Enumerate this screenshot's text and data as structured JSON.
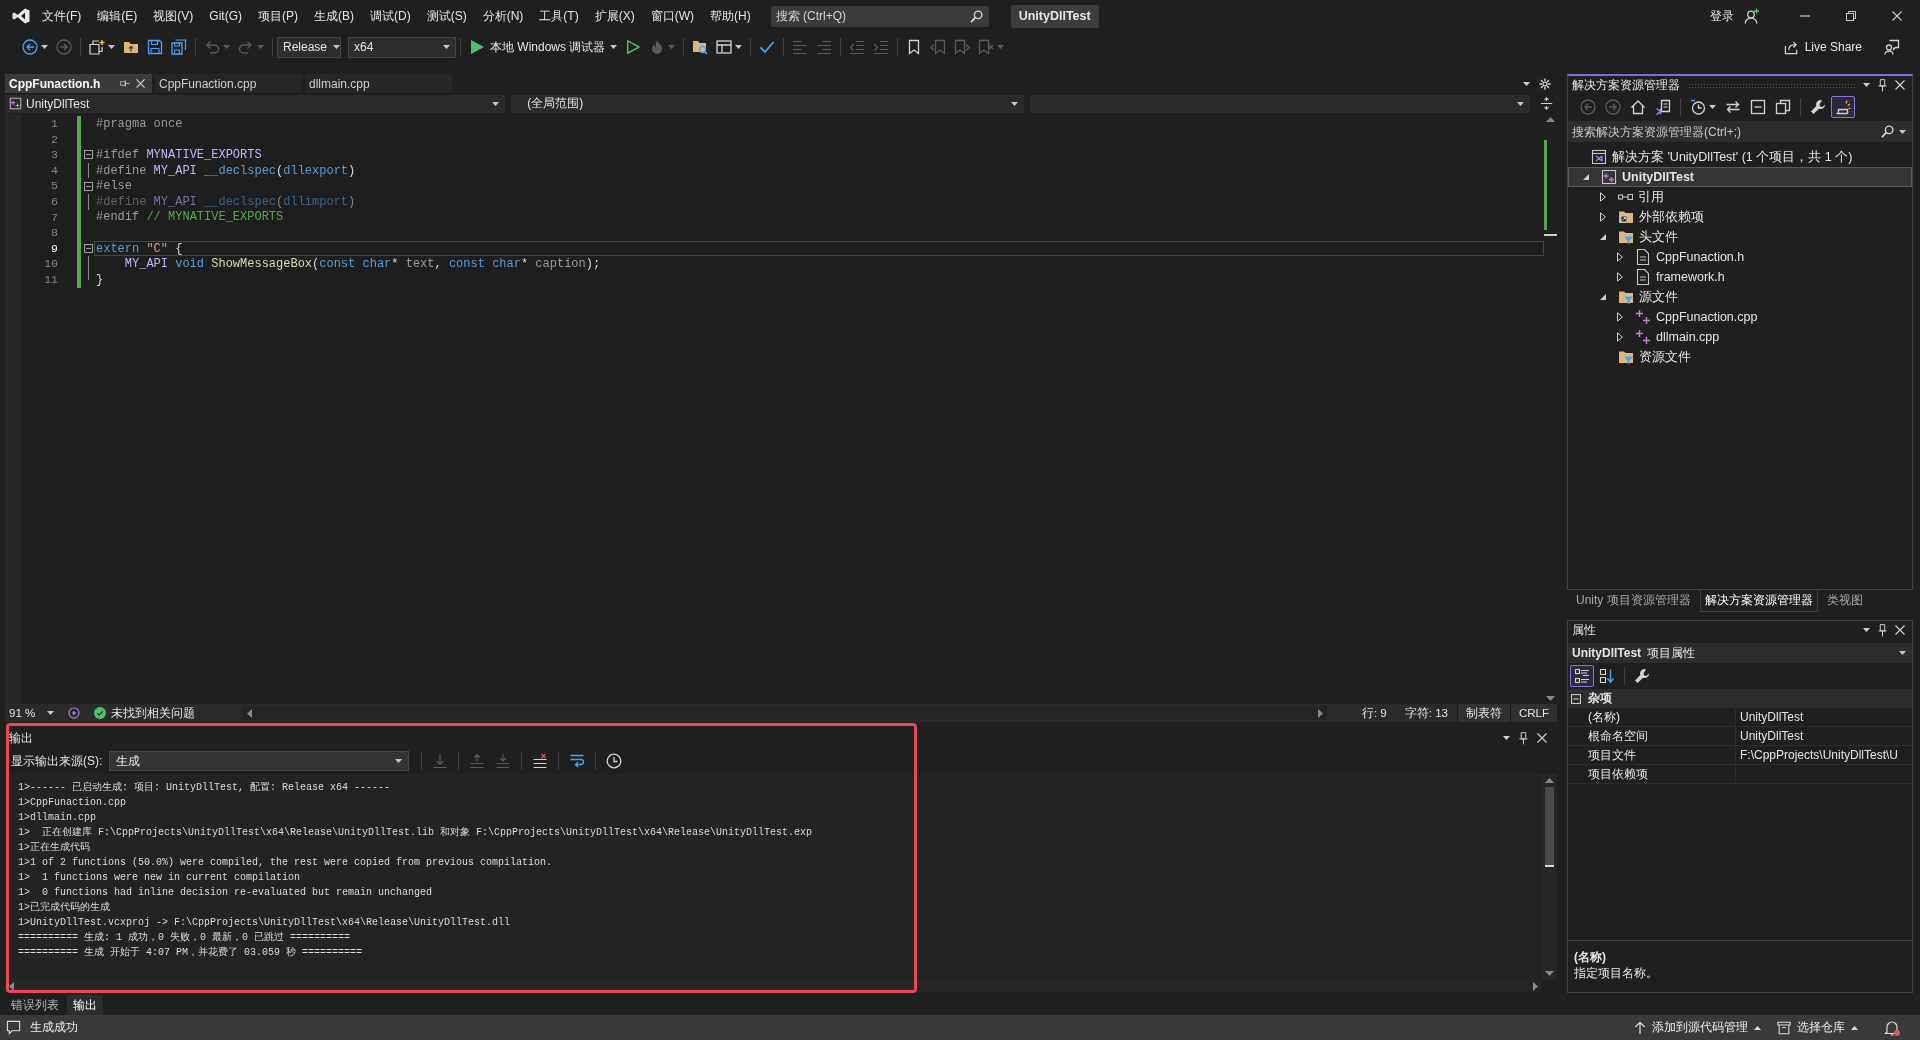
{
  "window": {
    "search": {
      "placeholder": "搜索 (Ctrl+Q)"
    },
    "solution_name": "UnityDllTest",
    "sign_in": "登录"
  },
  "menu": [
    "文件(F)",
    "编辑(E)",
    "视图(V)",
    "Git(G)",
    "项目(P)",
    "生成(B)",
    "调试(D)",
    "测试(S)",
    "分析(N)",
    "工具(T)",
    "扩展(X)",
    "窗口(W)",
    "帮助(H)"
  ],
  "toolbar": {
    "groups": [
      [
        {
          "kind": "back",
          "disabled": false,
          "dropdown": true
        },
        {
          "kind": "forward",
          "disabled": true
        }
      ],
      [
        {
          "kind": "new_item",
          "disabled": false,
          "dropdown": true
        },
        {
          "kind": "open",
          "disabled": false
        },
        {
          "kind": "save",
          "disabled": false
        },
        {
          "kind": "save_all",
          "disabled": false
        }
      ],
      [
        {
          "kind": "undo",
          "disabled": true,
          "dropdown": true
        },
        {
          "kind": "redo",
          "disabled": true,
          "dropdown": true
        }
      ],
      [
        {
          "kind": "configuration",
          "value": "Release"
        },
        {
          "kind": "platform",
          "value": "x64"
        }
      ],
      [
        {
          "kind": "run",
          "label": "本地 Windows 调试器",
          "disabled": false,
          "dropdown": true
        },
        {
          "kind": "run_outline",
          "disabled": false
        },
        {
          "kind": "hot_reload",
          "disabled": true,
          "dropdown": true
        }
      ],
      [
        {
          "kind": "find_folder",
          "disabled": false
        },
        {
          "kind": "layout",
          "disabled": false,
          "dropdown": true
        }
      ],
      [
        {
          "kind": "spellcheck",
          "disabled": false
        }
      ],
      [
        {
          "kind": "comment",
          "disabled": true
        },
        {
          "kind": "uncomment",
          "disabled": true
        }
      ],
      [
        {
          "kind": "outdent",
          "disabled": true
        },
        {
          "kind": "indent",
          "disabled": true
        }
      ],
      [
        {
          "kind": "bookmark",
          "disabled": false
        },
        {
          "kind": "bookmark_prev",
          "disabled": true
        },
        {
          "kind": "bookmark_next",
          "disabled": true
        },
        {
          "kind": "bookmark_clear",
          "disabled": true,
          "dropdown": true
        }
      ]
    ],
    "live_share": "Live Share"
  },
  "document_tabs": [
    {
      "label": "CppFunaction.h",
      "selected": true
    },
    {
      "label": "CppFunaction.cpp",
      "selected": false
    },
    {
      "label": "dllmain.cpp",
      "selected": false
    }
  ],
  "navigation_bar": {
    "project": "UnityDllTest",
    "scope": "(全局范围)"
  },
  "editor": {
    "lines": [
      {
        "number": "1",
        "kind": "plain",
        "tokens": [
          {
            "kind": "preprocessor",
            "text": "#pragma once"
          }
        ],
        "changed": true,
        "current": false,
        "inactive": false
      },
      {
        "number": "2",
        "kind": "plain",
        "changed": true,
        "current": false,
        "inactive": false
      },
      {
        "number": "3",
        "kind": "block_start",
        "tokens": [
          {
            "kind": "preprocessor",
            "text": "#ifdef "
          },
          {
            "kind": "macro",
            "text": "MYNATIVE_EXPORTS"
          }
        ],
        "changed": true,
        "current": false,
        "inactive": false
      },
      {
        "number": "4",
        "kind": "block_body",
        "tokens": [
          {
            "kind": "preprocessor",
            "text": "#define "
          },
          {
            "kind": "macro",
            "text": "MY_API"
          },
          {
            "kind": "keyword",
            "text": " __declspec"
          },
          {
            "kind": "plain",
            "text": "("
          },
          {
            "kind": "keyword",
            "text": "dllexport"
          },
          {
            "kind": "plain",
            "text": ")"
          }
        ],
        "changed": true,
        "current": false,
        "inactive": false
      },
      {
        "number": "5",
        "kind": "block_start",
        "tokens": [
          {
            "kind": "preprocessor",
            "text": "#else"
          }
        ],
        "changed": true,
        "current": false,
        "inactive": false
      },
      {
        "number": "6",
        "kind": "block_body",
        "tokens": [
          {
            "kind": "preprocessor",
            "text": "#define "
          },
          {
            "kind": "macro",
            "text": "MY_API"
          },
          {
            "kind": "keyword",
            "text": " __declspec"
          },
          {
            "kind": "plain",
            "text": "("
          },
          {
            "kind": "keyword",
            "text": "dllimport"
          },
          {
            "kind": "plain",
            "text": ")"
          }
        ],
        "changed": true,
        "current": false,
        "inactive": true
      },
      {
        "number": "7",
        "kind": "plain",
        "tokens": [
          {
            "kind": "preprocessor",
            "text": "#endif "
          },
          {
            "kind": "comment",
            "text": "// MYNATIVE_EXPORTS"
          }
        ],
        "changed": true,
        "current": false,
        "inactive": false
      },
      {
        "number": "8",
        "kind": "plain",
        "changed": true,
        "current": false,
        "inactive": false
      },
      {
        "number": "9",
        "kind": "block_start",
        "tokens": [
          {
            "kind": "keyword",
            "text": "extern"
          },
          {
            "kind": "string",
            "text": " \"C\""
          },
          {
            "kind": "plain",
            "text": " {"
          }
        ],
        "changed": true,
        "current": true,
        "inactive": false
      },
      {
        "number": "10",
        "kind": "block_body",
        "tokens": [
          {
            "kind": "macro",
            "text": "    MY_API"
          },
          {
            "kind": "keyword",
            "text": " void"
          },
          {
            "kind": "function",
            "text": " ShowMessageBox"
          },
          {
            "kind": "plain",
            "text": "("
          },
          {
            "kind": "keyword",
            "text": "const"
          },
          {
            "kind": "keyword",
            "text": " char"
          },
          {
            "kind": "plain",
            "text": "* "
          },
          {
            "kind": "parameter",
            "text": "text"
          },
          {
            "kind": "plain",
            "text": ", "
          },
          {
            "kind": "keyword",
            "text": "const"
          },
          {
            "kind": "keyword",
            "text": " char"
          },
          {
            "kind": "plain",
            "text": "* "
          },
          {
            "kind": "parameter",
            "text": "caption"
          },
          {
            "kind": "plain",
            "text": ");"
          }
        ],
        "changed": true,
        "current": false,
        "inactive": false
      },
      {
        "number": "11",
        "kind": "block_end",
        "tokens": [
          {
            "kind": "plain",
            "text": "}"
          }
        ],
        "changed": true,
        "current": false,
        "inactive": false
      }
    ]
  },
  "editor_status": {
    "zoom": "91 %",
    "issues": "未找到相关问题",
    "line": "行: 9",
    "column": "字符: 13",
    "indentation": "制表符",
    "line_ending": "CRLF"
  },
  "output": {
    "title": "输出",
    "highlighted": true,
    "source_label": "显示输出来源(S):",
    "source": "生成",
    "toolbar": {
      "groups": [
        [
          {
            "kind": "find_message",
            "disabled": true
          }
        ],
        [
          {
            "kind": "prev_message",
            "disabled": true
          },
          {
            "kind": "next_message",
            "disabled": true
          }
        ],
        [
          {
            "kind": "clear_all",
            "disabled": false
          }
        ],
        [
          {
            "kind": "word_wrap",
            "disabled": false
          }
        ],
        [
          {
            "kind": "timestamps",
            "disabled": false
          }
        ]
      ]
    },
    "lines": [
      "1>------ 已启动生成: 项目: UnityDllTest, 配置: Release x64 ------",
      "1>CppFunaction.cpp",
      "1>dllmain.cpp",
      "1>  正在创建库 F:\\CppProjects\\UnityDllTest\\x64\\Release\\UnityDllTest.lib 和对象 F:\\CppProjects\\UnityDllTest\\x64\\Release\\UnityDllTest.exp",
      "1>正在生成代码",
      "1>1 of 2 functions (50.0%) were compiled, the rest were copied from previous compilation.",
      "1>  1 functions were new in current compilation",
      "1>  0 functions had inline decision re-evaluated but remain unchanged",
      "1>已完成代码的生成",
      "1>UnityDllTest.vcxproj -> F:\\CppProjects\\UnityDllTest\\x64\\Release\\UnityDllTest.dll",
      "========== 生成: 1 成功，0 失败，0 最新，0 已跳过 ==========",
      "========== 生成 开始于 4:07 PM，并花费了 03.059 秒 =========="
    ]
  },
  "bottom_tabs": [
    {
      "label": "错误列表",
      "selected": false
    },
    {
      "label": "输出",
      "selected": true
    }
  ],
  "solution_explorer": {
    "title": "解决方案资源管理器",
    "toolbar": {
      "groups": [
        [
          {
            "kind": "back",
            "disabled": true,
            "pressed": false
          },
          {
            "kind": "forward",
            "disabled": true,
            "pressed": false
          },
          {
            "kind": "home",
            "disabled": false,
            "pressed": false
          },
          {
            "kind": "switch_views",
            "disabled": false,
            "pressed": false
          }
        ],
        [
          {
            "kind": "history",
            "disabled": false,
            "pressed": false,
            "dropdown": true
          },
          {
            "kind": "sync",
            "disabled": false,
            "pressed": false
          },
          {
            "kind": "collapse_all",
            "disabled": false,
            "pressed": false
          },
          {
            "kind": "show_all",
            "disabled": false,
            "pressed": false
          }
        ],
        [
          {
            "kind": "properties",
            "disabled": false,
            "pressed": false
          },
          {
            "kind": "preview",
            "disabled": false,
            "pressed": true
          }
        ]
      ]
    },
    "search": {
      "placeholder": "搜索解决方案资源管理器(Ctrl+;)"
    },
    "tree": [
      {
        "label": "解决方案 'UnityDllTest' (1 个项目，共 1 个)",
        "kind": "solution",
        "selected": false,
        "children": [
          {
            "label": "UnityDllTest",
            "kind": "project",
            "selected": true,
            "expanded": true,
            "children": [
              {
                "label": "引用",
                "kind": "references",
                "selected": false,
                "expanded": false
              },
              {
                "label": "外部依赖项",
                "kind": "external",
                "selected": false,
                "expanded": false
              },
              {
                "label": "头文件",
                "kind": "filter",
                "selected": false,
                "expanded": true,
                "children": [
                  {
                    "label": "CppFunaction.h",
                    "kind": "header",
                    "selected": false,
                    "expanded": false
                  },
                  {
                    "label": "framework.h",
                    "kind": "header",
                    "selected": false,
                    "expanded": false
                  }
                ]
              },
              {
                "label": "源文件",
                "kind": "filter",
                "selected": false,
                "expanded": true,
                "children": [
                  {
                    "label": "CppFunaction.cpp",
                    "kind": "source",
                    "selected": false,
                    "expanded": false
                  },
                  {
                    "label": "dllmain.cpp",
                    "kind": "source",
                    "selected": false,
                    "expanded": false
                  }
                ]
              },
              {
                "label": "资源文件",
                "kind": "filter",
                "selected": false
              }
            ]
          }
        ]
      }
    ]
  },
  "panel_tabs": [
    {
      "label": "Unity 项目资源管理器",
      "selected": false
    },
    {
      "label": "解决方案资源管理器",
      "selected": true
    },
    {
      "label": "类视图",
      "selected": false
    }
  ],
  "properties": {
    "title": "属性",
    "object": "UnityDllTest",
    "object_type": "项目属性",
    "toolbar": {
      "groups": [
        [
          {
            "kind": "categorized",
            "pressed": true
          },
          {
            "kind": "alphabetical",
            "pressed": false
          }
        ],
        [
          {
            "kind": "property_pages",
            "pressed": false
          }
        ]
      ]
    },
    "category": {
      "label": "杂项",
      "expanded": true
    },
    "rows": [
      {
        "name": "(名称)",
        "value": "UnityDllTest"
      },
      {
        "name": "根命名空间",
        "value": "UnityDllTest"
      },
      {
        "name": "项目文件",
        "value": "F:\\CppProjects\\UnityDllTest\\U"
      },
      {
        "name": "项目依赖项"
      }
    ],
    "description": {
      "title": "(名称)",
      "text": "指定项目名称。"
    }
  },
  "status_bar": {
    "message": "生成成功",
    "source_control": "添加到源代码管理",
    "repository": "选择仓库"
  }
}
